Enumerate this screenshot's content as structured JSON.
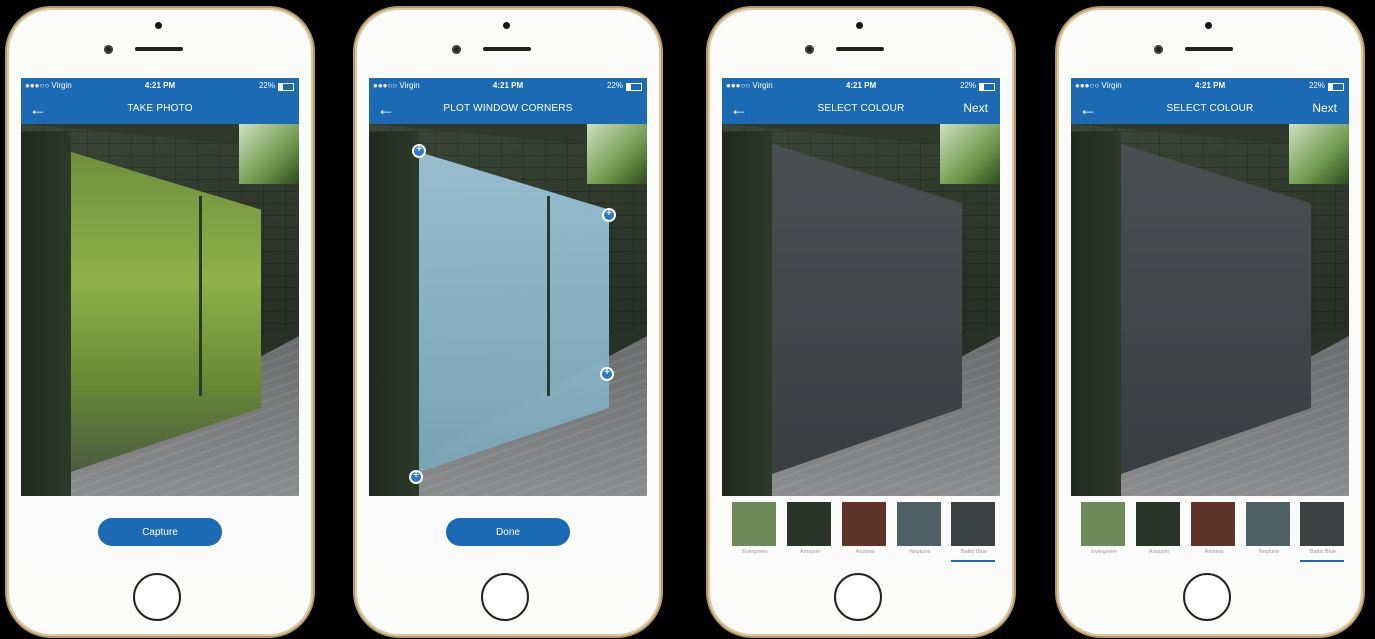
{
  "status": {
    "carrier": "●●●○○ Virgin",
    "time": "4:21 PM",
    "battery": "22%"
  },
  "screens": [
    {
      "title": "TAKE PHOTO",
      "button": "Capture"
    },
    {
      "title": "PLOT WINDOW CORNERS",
      "button": "Done"
    },
    {
      "title": "SELECT COLOUR",
      "next": "Next"
    },
    {
      "title": "SELECT COLOUR",
      "next": "Next"
    }
  ],
  "swatches": [
    {
      "name": "Evergreen",
      "color": "#6f8a5a"
    },
    {
      "name": "Amazon",
      "color": "#2a3529"
    },
    {
      "name": "Arizona",
      "color": "#5d3427"
    },
    {
      "name": "Neptune",
      "color": "#4f6066"
    },
    {
      "name": "Baltic Blue",
      "color": "#3c4142"
    }
  ],
  "colors": {
    "accent": "#1c6ab3"
  }
}
